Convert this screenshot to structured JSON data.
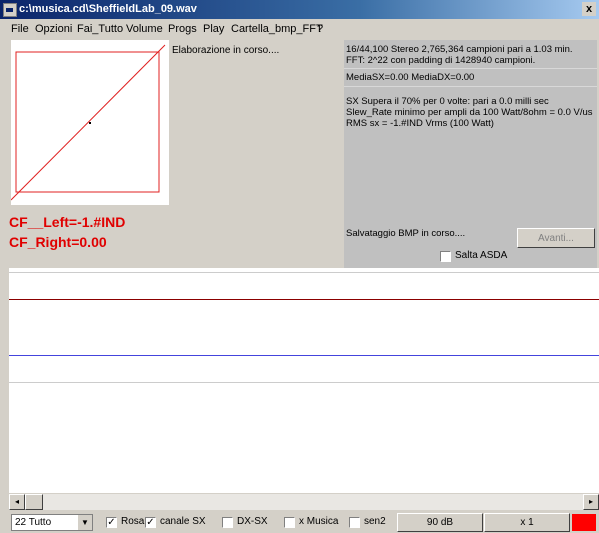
{
  "window": {
    "title": "c:\\musica.cd\\SheffieldLab_09.wav",
    "close_symbol": "x"
  },
  "menu": [
    "File",
    "Opzioni",
    "Fai_Tutto",
    "Volume",
    "Progs",
    "Play",
    "Cartella_bmp_FFT",
    "?"
  ],
  "status": {
    "processing": "Elaborazione in corso....",
    "saving_bmp": "Salvataggio BMP in corso...."
  },
  "crest_factor": {
    "left": "CF__Left=-1.#IND",
    "right": "CF_Right=0.00"
  },
  "info": {
    "line1": "16/44,100 Stereo 2,765,364 campioni pari a 1.03 min.",
    "line2": "FFT: 2^22 con padding di 1428940 campioni.",
    "media": "MediaSX=0.00  MediaDX=0.00",
    "supera": "SX Supera il 70% per 0 volte: pari a 0.0 milli sec",
    "slew": "Slew_Rate minimo per ampli da 100 Watt/8ohm = 0.0 V/us",
    "rms": "RMS sx = -1.#IND Vrms (100 Watt)"
  },
  "buttons": {
    "avanti": "Avanti...",
    "db": "90 dB",
    "zoom": "x 1"
  },
  "checkboxes": {
    "salta_asda": {
      "label": "Salta ASDA",
      "checked": false
    },
    "rosa": {
      "label": "Rosa",
      "checked": true
    },
    "canale_sx": {
      "label": "canale SX",
      "checked": true
    },
    "dx_sx": {
      "label": "DX-SX",
      "checked": false
    },
    "x_musica": {
      "label": "x Musica",
      "checked": false
    },
    "sen2": {
      "label": "sen2",
      "checked": false
    }
  },
  "dropdown": {
    "selected": "22 Tutto"
  },
  "check_mark": "✓",
  "colors": {
    "title_bar": "#0a246a",
    "accent_red": "#e00000",
    "left_channel": "#8b0000",
    "right_channel": "#4444dd",
    "color_swatch": "#ff0000"
  },
  "icons": {
    "scroll_left": "◂",
    "scroll_right": "▸",
    "dropdown_arrow": "▼"
  }
}
